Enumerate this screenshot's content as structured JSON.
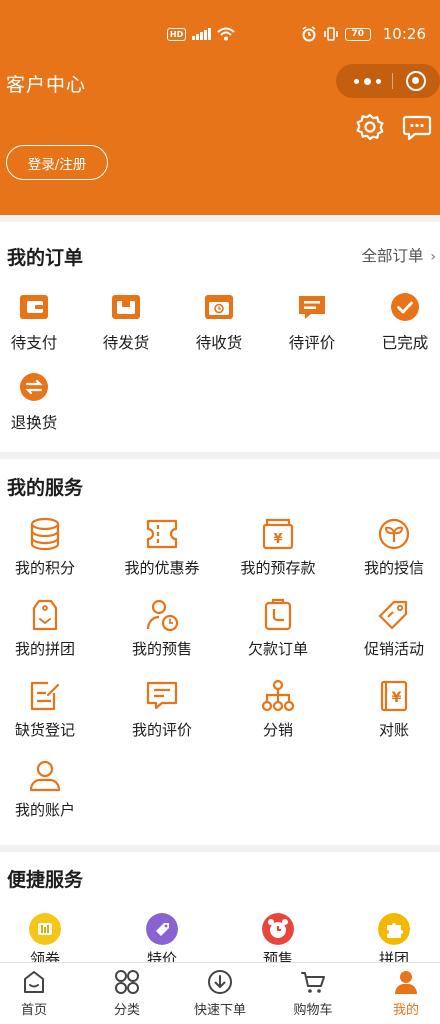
{
  "status_bar": {
    "network": "HD",
    "battery": "70",
    "time": "10:26"
  },
  "header": {
    "title": "客户中心",
    "login_label": "登录/注册",
    "settings_icon": "gear-icon",
    "message_icon": "message-icon"
  },
  "orders": {
    "title": "我的订单",
    "all_label": "全部订单",
    "items": [
      {
        "label": "待支付",
        "icon": "wallet-icon"
      },
      {
        "label": "待发货",
        "icon": "box-icon"
      },
      {
        "label": "待收货",
        "icon": "delivery-icon"
      },
      {
        "label": "待评价",
        "icon": "comment-icon"
      },
      {
        "label": "已完成",
        "icon": "check-circle-icon"
      },
      {
        "label": "退换货",
        "icon": "exchange-icon"
      }
    ]
  },
  "services": {
    "title": "我的服务",
    "items": [
      {
        "label": "我的积分",
        "icon": "coins-icon"
      },
      {
        "label": "我的优惠券",
        "icon": "coupon-icon"
      },
      {
        "label": "我的预存款",
        "icon": "deposit-icon"
      },
      {
        "label": "我的授信",
        "icon": "credit-icon"
      },
      {
        "label": "我的拼团",
        "icon": "group-tag-icon"
      },
      {
        "label": "我的预售",
        "icon": "presale-icon"
      },
      {
        "label": "欠款订单",
        "icon": "debt-order-icon"
      },
      {
        "label": "促销活动",
        "icon": "promotion-icon"
      },
      {
        "label": "缺货登记",
        "icon": "stockout-icon"
      },
      {
        "label": "我的评价",
        "icon": "review-icon"
      },
      {
        "label": "分销",
        "icon": "distribution-icon"
      },
      {
        "label": "对账",
        "icon": "reconcile-icon"
      },
      {
        "label": "我的账户",
        "icon": "account-icon"
      }
    ]
  },
  "quick": {
    "title": "便捷服务",
    "items": [
      {
        "label": "领券",
        "icon": "coupon-badge-icon"
      },
      {
        "label": "特价",
        "icon": "special-price-icon"
      },
      {
        "label": "预售",
        "icon": "alarm-icon"
      },
      {
        "label": "拼团",
        "icon": "puzzle-icon"
      }
    ]
  },
  "tabbar": {
    "active": "我的",
    "active_color": "#e8741a",
    "items": [
      {
        "label": "首页",
        "icon": "home-icon"
      },
      {
        "label": "分类",
        "icon": "category-icon"
      },
      {
        "label": "快速下单",
        "icon": "quick-order-icon"
      },
      {
        "label": "购物车",
        "icon": "cart-icon"
      },
      {
        "label": "我的",
        "icon": "user-icon"
      }
    ]
  },
  "colors": {
    "brand": "#e8741a"
  }
}
